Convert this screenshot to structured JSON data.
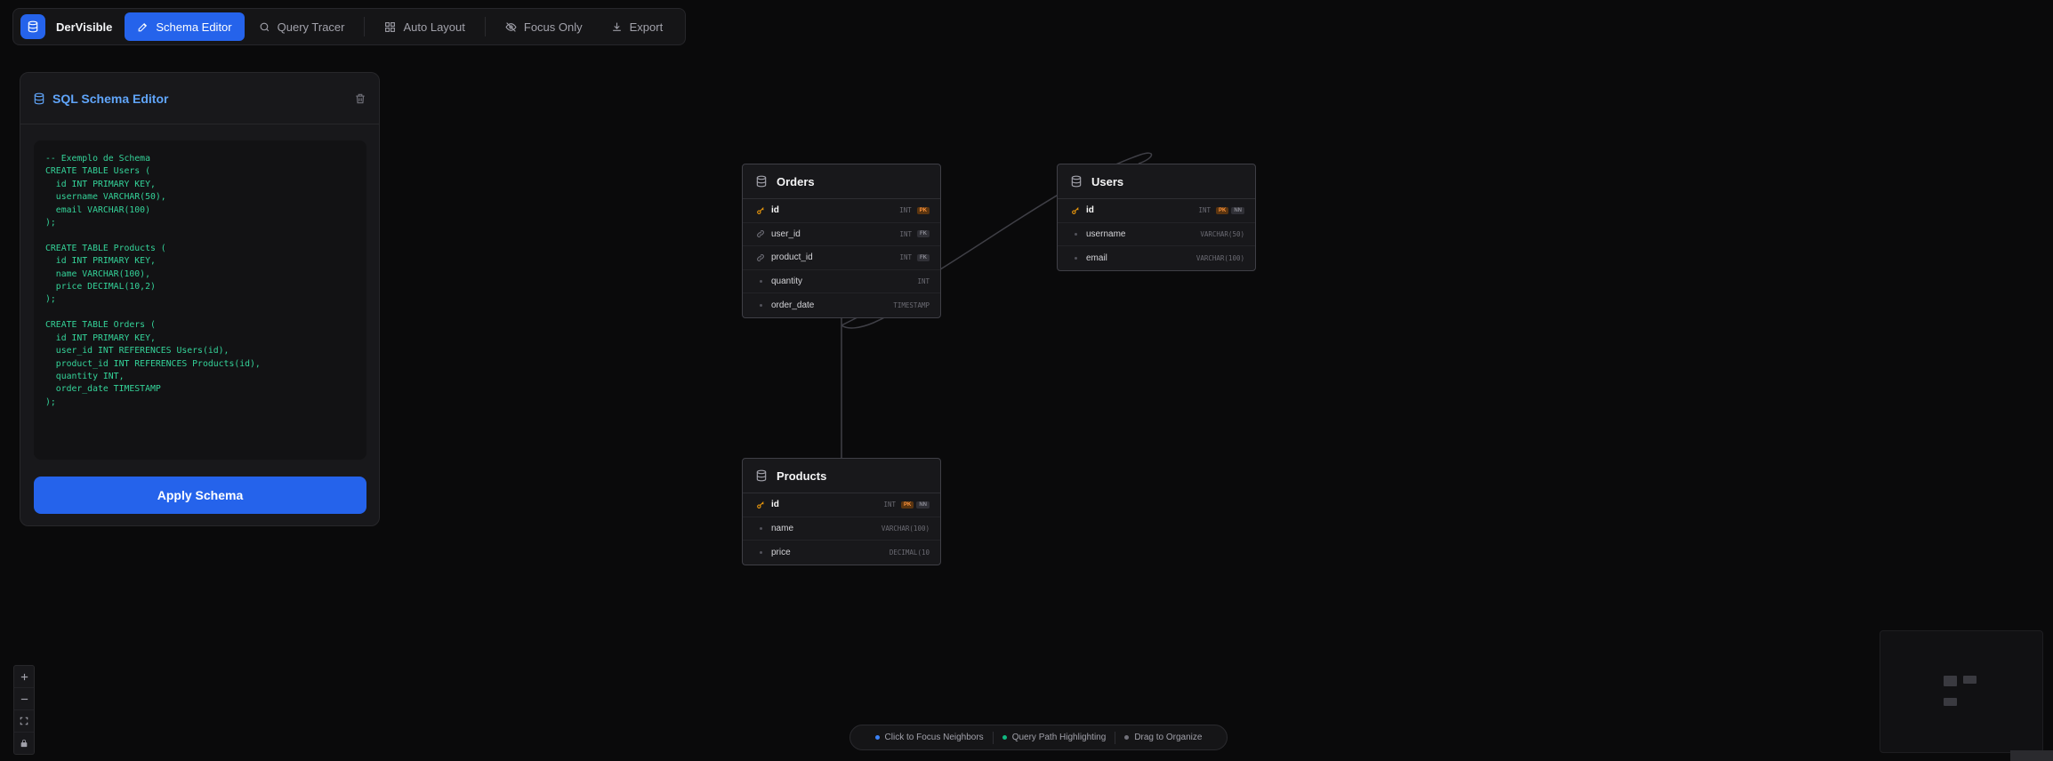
{
  "toolbar": {
    "brand": "DerVisible",
    "buttons": [
      {
        "label": "Schema Editor",
        "icon": "pencil-icon",
        "active": true
      },
      {
        "label": "Query Tracer",
        "icon": "search-icon"
      },
      {
        "label": "Auto Layout",
        "icon": "layout-grid-icon"
      },
      {
        "label": "Focus Only",
        "icon": "eye-off-icon"
      },
      {
        "label": "Export",
        "icon": "download-icon"
      }
    ]
  },
  "editor": {
    "title": "SQL Schema Editor",
    "code": "-- Exemplo de Schema\nCREATE TABLE Users (\n  id INT PRIMARY KEY,\n  username VARCHAR(50),\n  email VARCHAR(100)\n);\n\nCREATE TABLE Products (\n  id INT PRIMARY KEY,\n  name VARCHAR(100),\n  price DECIMAL(10,2)\n);\n\nCREATE TABLE Orders (\n  id INT PRIMARY KEY,\n  user_id INT REFERENCES Users(id),\n  product_id INT REFERENCES Products(id),\n  quantity INT,\n  order_date TIMESTAMP\n);",
    "apply_label": "Apply Schema"
  },
  "tables": {
    "orders": {
      "name": "Orders",
      "columns": [
        {
          "name": "id",
          "type": "INT",
          "pk": "PK",
          "kind": "pk"
        },
        {
          "name": "user_id",
          "type": "INT",
          "fk": "FK",
          "kind": "fk"
        },
        {
          "name": "product_id",
          "type": "INT",
          "fk": "FK",
          "kind": "fk"
        },
        {
          "name": "quantity",
          "type": "INT",
          "kind": "plain"
        },
        {
          "name": "order_date",
          "type": "TIMESTAMP",
          "kind": "plain"
        }
      ]
    },
    "users": {
      "name": "Users",
      "columns": [
        {
          "name": "id",
          "type": "INT",
          "pk": "PK",
          "nn": "NN",
          "kind": "pk"
        },
        {
          "name": "username",
          "type": "VARCHAR(50)",
          "kind": "plain"
        },
        {
          "name": "email",
          "type": "VARCHAR(100)",
          "kind": "plain"
        }
      ]
    },
    "products": {
      "name": "Products",
      "columns": [
        {
          "name": "id",
          "type": "INT",
          "pk": "PK",
          "nn": "NN",
          "kind": "pk"
        },
        {
          "name": "name",
          "type": "VARCHAR(100)",
          "kind": "plain"
        },
        {
          "name": "price",
          "type": "DECIMAL(10",
          "kind": "plain"
        }
      ]
    }
  },
  "legend": {
    "items": [
      {
        "label": "Click to Focus Neighbors",
        "color": "#3b82f6"
      },
      {
        "label": "Query Path Highlighting",
        "color": "#10b981"
      },
      {
        "label": "Drag to Organize",
        "color": "#71717a"
      }
    ]
  },
  "zoom_controls": [
    "zoom-in-icon",
    "zoom-out-icon",
    "fit-view-icon",
    "lock-icon"
  ],
  "colors": {
    "accent": "#2563eb",
    "code": "#34d399",
    "pk": "#f59e0b",
    "background": "#0a0a0b"
  }
}
